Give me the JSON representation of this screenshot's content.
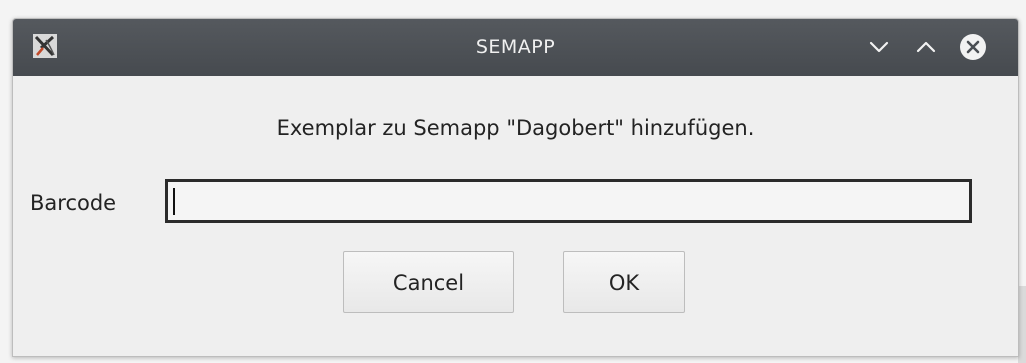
{
  "window": {
    "title": "SEMAPP",
    "icons": {
      "app": "x-logo-icon",
      "minimize": "chevron-down-icon",
      "maximize": "chevron-up-icon",
      "close": "close-circle-icon"
    }
  },
  "dialog": {
    "message": "Exemplar zu Semapp \"Dagobert\" hinzufügen.",
    "barcode_label": "Barcode",
    "barcode_value": "",
    "cancel_label": "Cancel",
    "ok_label": "OK"
  },
  "colors": {
    "titlebar": "#4e5257",
    "background": "#efefef",
    "input_border": "#2b2b2b"
  }
}
